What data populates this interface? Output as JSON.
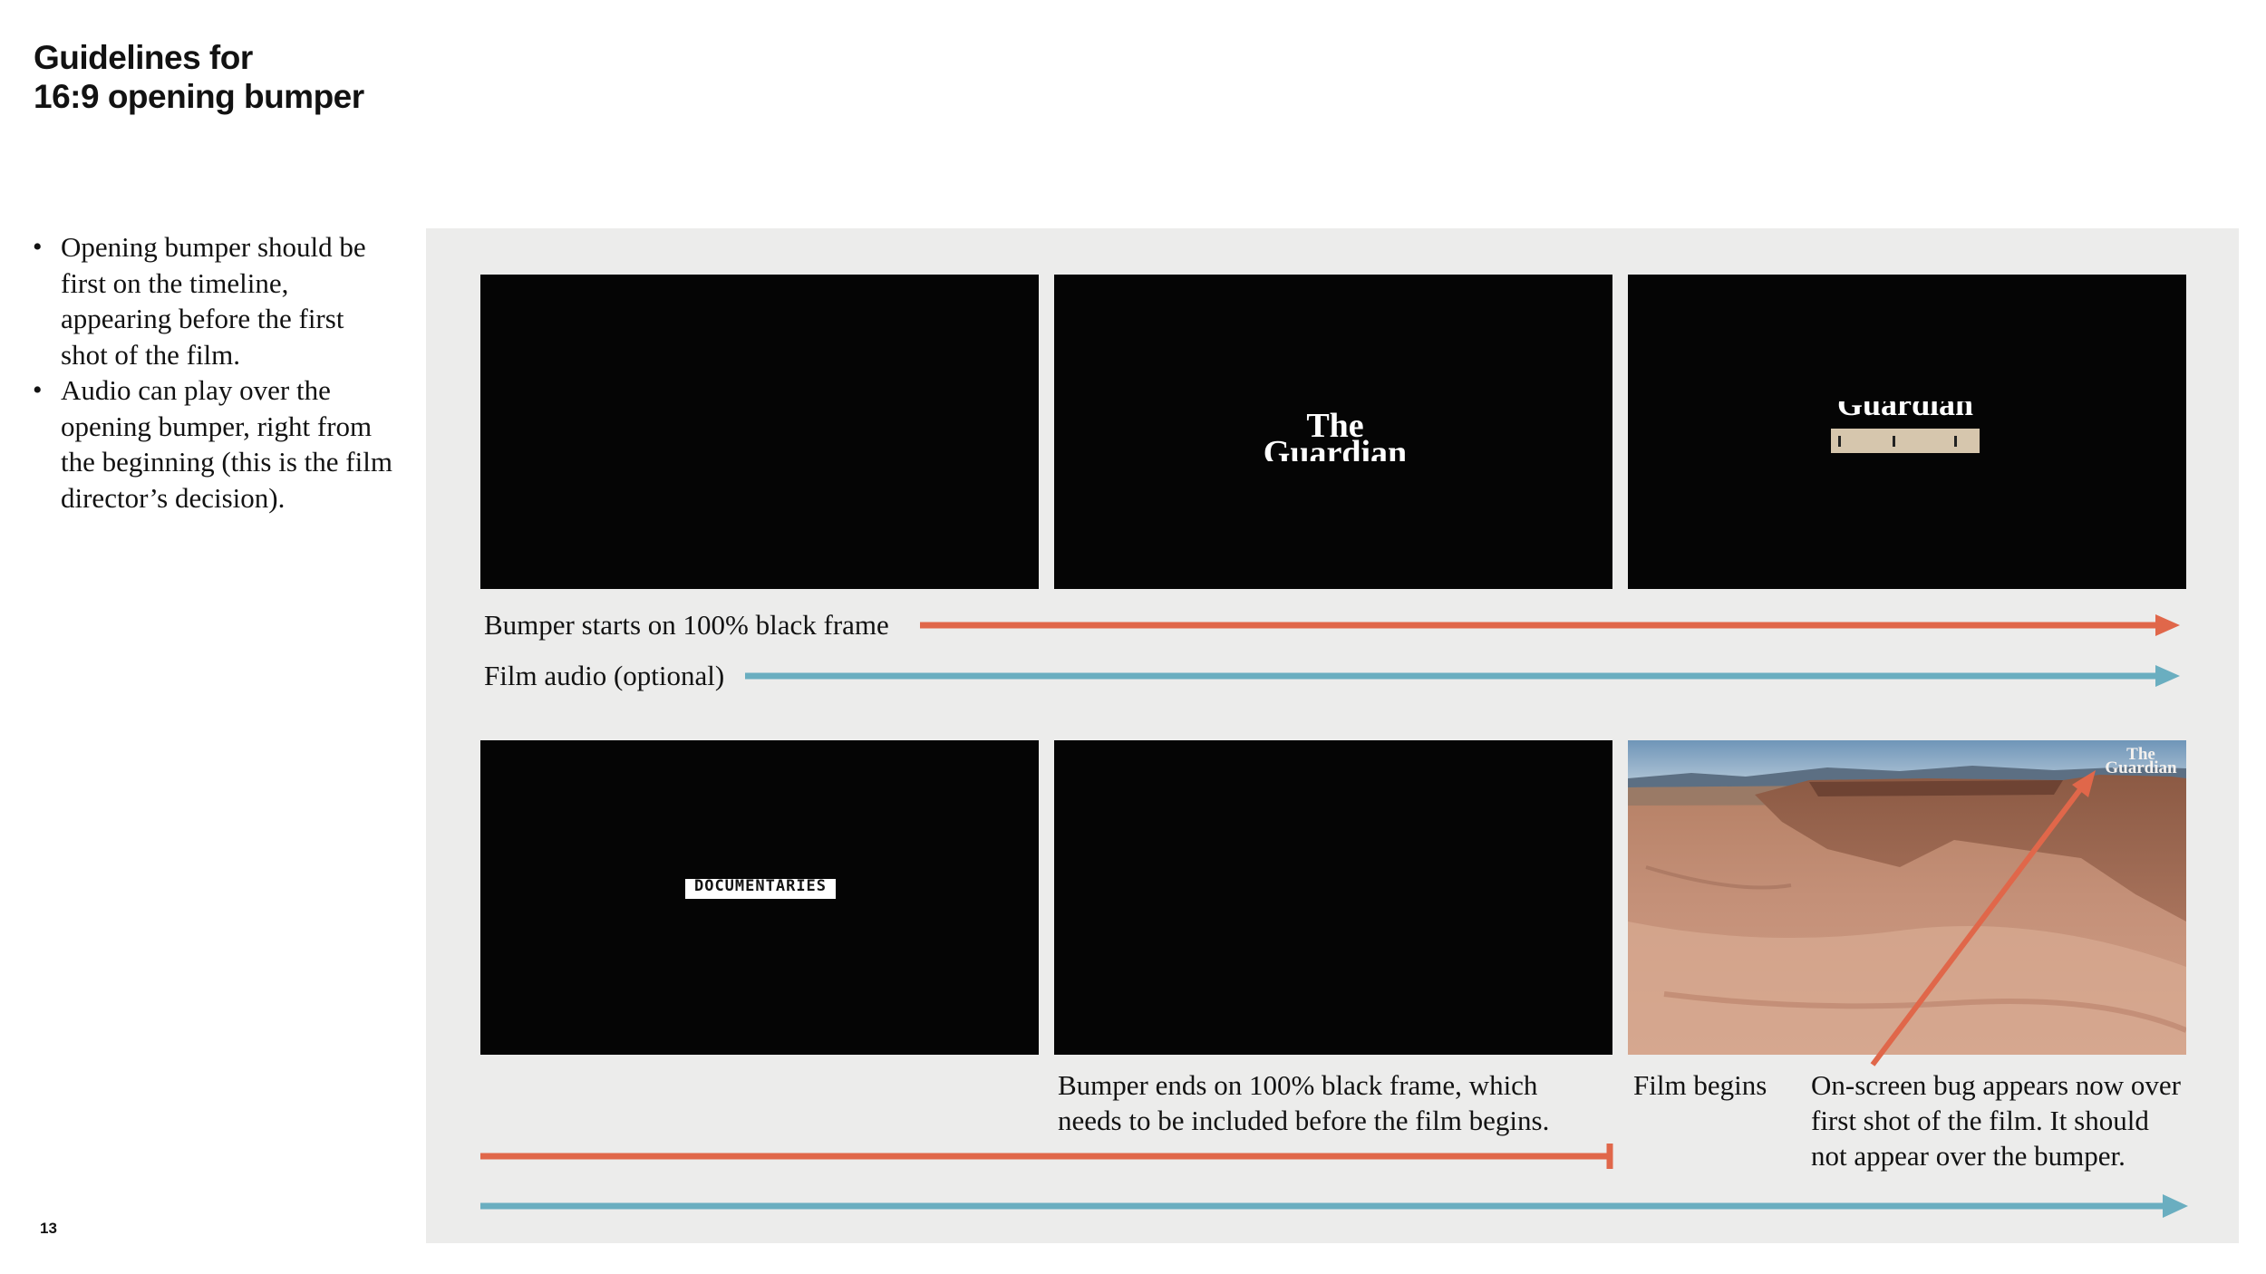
{
  "header": {
    "title_line1": "Guidelines for",
    "title_line2": "16:9 opening bumper"
  },
  "bullets": [
    "Opening bumper should be first on the timeline, appearing before the first shot of the film.",
    "Audio can play over the opening bumper, right from the beginning (this is the film director’s decision)."
  ],
  "page_number": "13",
  "frames": {
    "frame2_logo_line1": "The",
    "frame2_logo_line2": "Guardian",
    "frame3_logo": "Guardian",
    "frame4_label": "DOCUMENTARIES",
    "frame6_bug_line1": "The",
    "frame6_bug_line2": "Guardian"
  },
  "captions": {
    "bumper_start": "Bumper starts on 100% black frame",
    "film_audio": "Film audio (optional)",
    "bumper_end_line1": "Bumper ends on 100% black frame, which",
    "bumper_end_line2": "needs to be included before the film begins.",
    "film_begins": "Film begins",
    "bug_line1": "On-screen bug appears now over",
    "bug_line2": "first shot of the film. It should",
    "bug_line3": "not appear over the bumper."
  },
  "colors": {
    "bumper_arrow": "#e0674a",
    "audio_arrow": "#6aaec0",
    "panel_bg": "#ececeb",
    "frame_bg": "#050505"
  }
}
